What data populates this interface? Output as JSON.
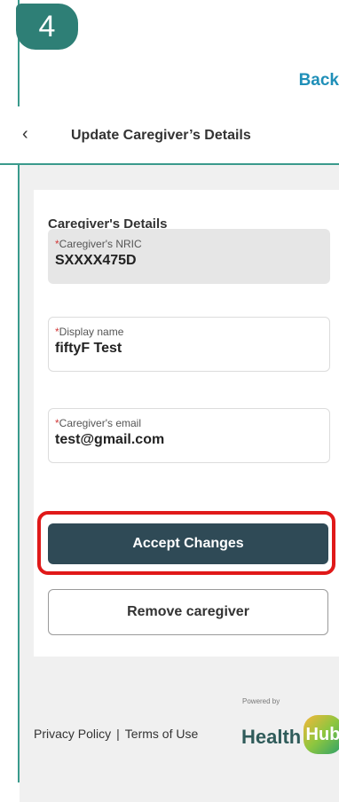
{
  "step_number": "4",
  "back_link": "Back",
  "header": {
    "title": "Update Caregiver’s Details"
  },
  "form": {
    "section_title": "Caregiver's Details",
    "required_mark": "*",
    "fields": [
      {
        "label": "Caregiver's NRIC",
        "value": "SXXXX475D",
        "readonly": true
      },
      {
        "label": "Display name",
        "value": "fiftyF Test",
        "readonly": false
      },
      {
        "label": "Caregiver's email",
        "value": "test@gmail.com",
        "readonly": false
      }
    ]
  },
  "buttons": {
    "accept": "Accept Changes",
    "remove": "Remove caregiver"
  },
  "footer": {
    "privacy": "Privacy Policy",
    "separator": "|",
    "terms": "Terms of Use",
    "powered_by": "Powered by",
    "logo_text": "Health",
    "logo_badge": "Hub"
  },
  "colors": {
    "accent_teal": "#2e7f76",
    "link_blue": "#1f8fb8",
    "primary_button": "#2f4a56",
    "highlight_red": "#e01919",
    "required_red": "#d23a3a"
  },
  "icons": [
    "chevron-left-icon"
  ]
}
